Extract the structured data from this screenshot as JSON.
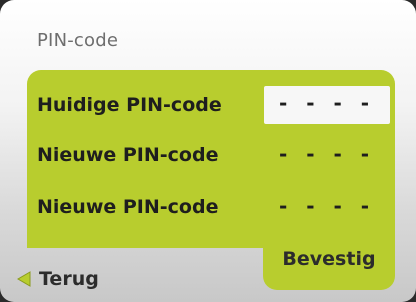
{
  "screen": {
    "title": "PIN-code"
  },
  "form": {
    "rows": [
      {
        "label": "Huidige PIN-code",
        "value": "- - - -",
        "active": true
      },
      {
        "label": "Nieuwe PIN-code",
        "value": "- - - -",
        "active": false
      },
      {
        "label": "Nieuwe PIN-code",
        "value": "- - - -",
        "active": false
      }
    ]
  },
  "actions": {
    "confirm_label": "Bevestig",
    "back_label": "Terug",
    "back_icon": "triangle-left-icon"
  },
  "colors": {
    "panel": "#b8cd2e",
    "active_field": "#f7f7f7",
    "back_icon": "#b8cd2e"
  }
}
